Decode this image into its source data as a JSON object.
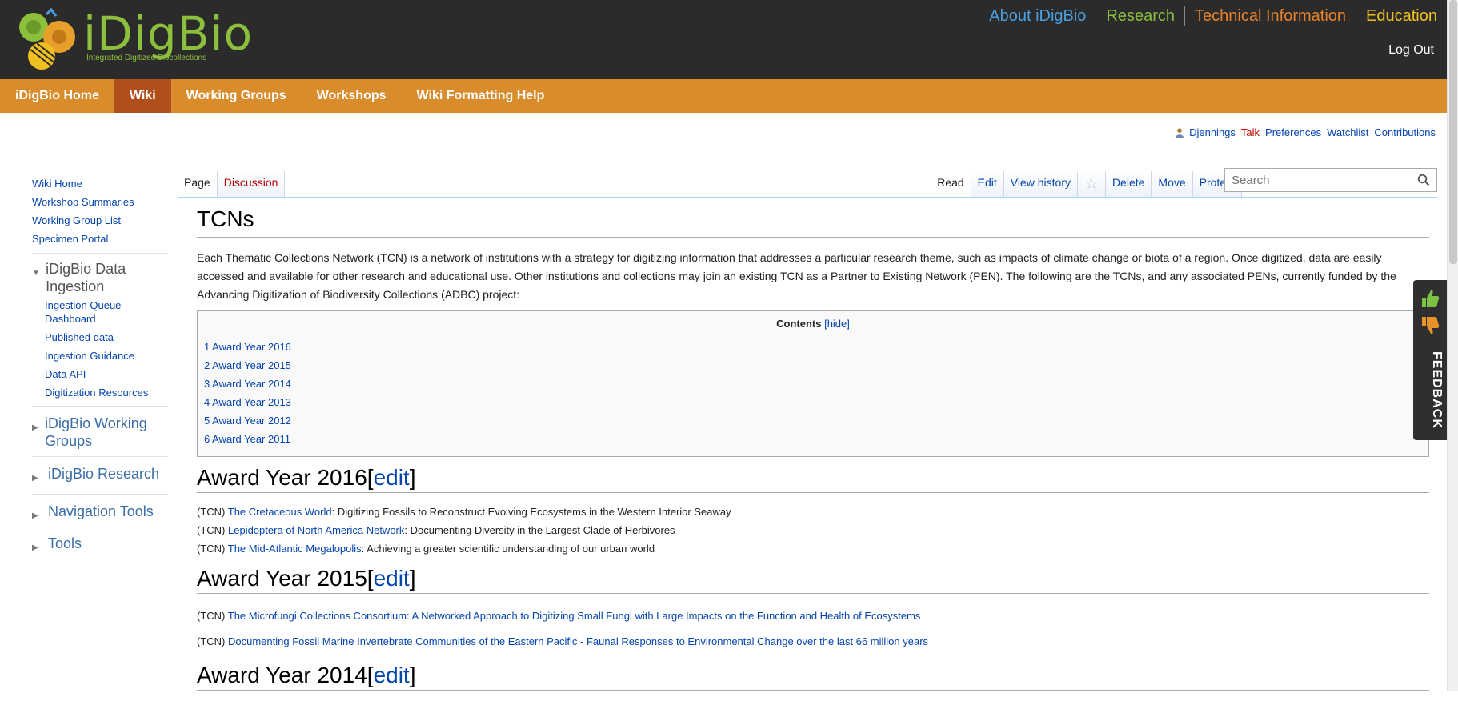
{
  "header": {
    "logo_text": "iDigBio",
    "logo_tagline": "Integrated Digitized Biocollections",
    "top_nav": [
      "About iDigBio",
      "Research",
      "Technical Information",
      "Education"
    ],
    "logout": "Log Out",
    "colors": {
      "bar": "#2b2b2b",
      "about": "#4a9fe0",
      "research": "#8bbf3c",
      "technical": "#e8822a",
      "education": "#f0c020"
    }
  },
  "orange_nav": {
    "items": [
      "iDigBio Home",
      "Wiki",
      "Working Groups",
      "Workshops",
      "Wiki Formatting Help"
    ],
    "active": "Wiki",
    "colors": {
      "bar": "#d98c2c",
      "active": "#b14f1c"
    }
  },
  "personal_tools": {
    "user": "Djennings",
    "talk": "Talk",
    "preferences": "Preferences",
    "watchlist": "Watchlist",
    "contributions": "Contributions"
  },
  "sidebar": {
    "top_links": [
      "Wiki Home",
      "Workshop Summaries",
      "Working Group List",
      "Specimen Portal"
    ],
    "data_ingestion": {
      "title": "iDigBio Data Ingestion",
      "items": [
        "Ingestion Queue Dashboard",
        "Published data",
        "Ingestion Guidance",
        "Data API",
        "Digitization Resources"
      ]
    },
    "collapsed": [
      "iDigBio Working Groups",
      "iDigBio Research",
      "Navigation Tools",
      "Tools"
    ]
  },
  "tabs": {
    "left": [
      "Page",
      "Discussion"
    ],
    "right": [
      "Read",
      "Edit",
      "View history",
      "Delete",
      "Move",
      "Protect"
    ],
    "search_placeholder": "Search"
  },
  "content": {
    "title": "TCNs",
    "intro": "Each Thematic Collections Network (TCN) is a network of institutions with a strategy for digitizing information that addresses a particular research theme, such as impacts of climate change or biota of a region. Once digitized, data are easily accessed and available for other research and educational use. Other institutions and collections may join an existing TCN as a Partner to Existing Network (PEN). The following are the TCNs, and any associated PENs, currently funded by the Advancing Digitization of Biodiversity Collections (ADBC) project:",
    "toc": {
      "title": "Contents",
      "hide": "[hide]",
      "items": [
        "1 Award Year 2016",
        "2 Award Year 2015",
        "3 Award Year 2014",
        "4 Award Year 2013",
        "5 Award Year 2012",
        "6 Award Year 2011"
      ]
    },
    "sections": [
      {
        "heading": "Award Year 2016",
        "edit": "edit",
        "entries": [
          {
            "prefix": "(TCN) ",
            "link": "The Cretaceous World",
            "rest": ": Digitizing Fossils to Reconstruct Evolving Ecosystems in the Western Interior Seaway"
          },
          {
            "prefix": "(TCN) ",
            "link": "Lepidoptera of North America Network",
            "rest": ": Documenting Diversity in the Largest Clade of Herbivores"
          },
          {
            "prefix": "(TCN) ",
            "link": "The Mid-Atlantic Megalopolis",
            "rest": ": Achieving a greater scientific understanding of our urban world"
          }
        ]
      },
      {
        "heading": "Award Year 2015",
        "edit": "edit",
        "entries": [
          {
            "prefix": "(TCN) ",
            "link": "The Microfungi Collections Consortium: A Networked Approach to Digitizing Small Fungi with Large Impacts on the Function and Health of Ecosystems",
            "rest": ""
          },
          {
            "prefix": "(TCN) ",
            "link": "Documenting Fossil Marine Invertebrate Communities of the Eastern Pacific - Faunal Responses to Environmental Change over the last 66 million years",
            "rest": ""
          }
        ]
      },
      {
        "heading": "Award Year 2014",
        "edit": "edit",
        "entries": []
      }
    ]
  },
  "feedback": {
    "label": "FEEDBACK",
    "up_color": "#7cc142",
    "down_color": "#e8922a"
  }
}
